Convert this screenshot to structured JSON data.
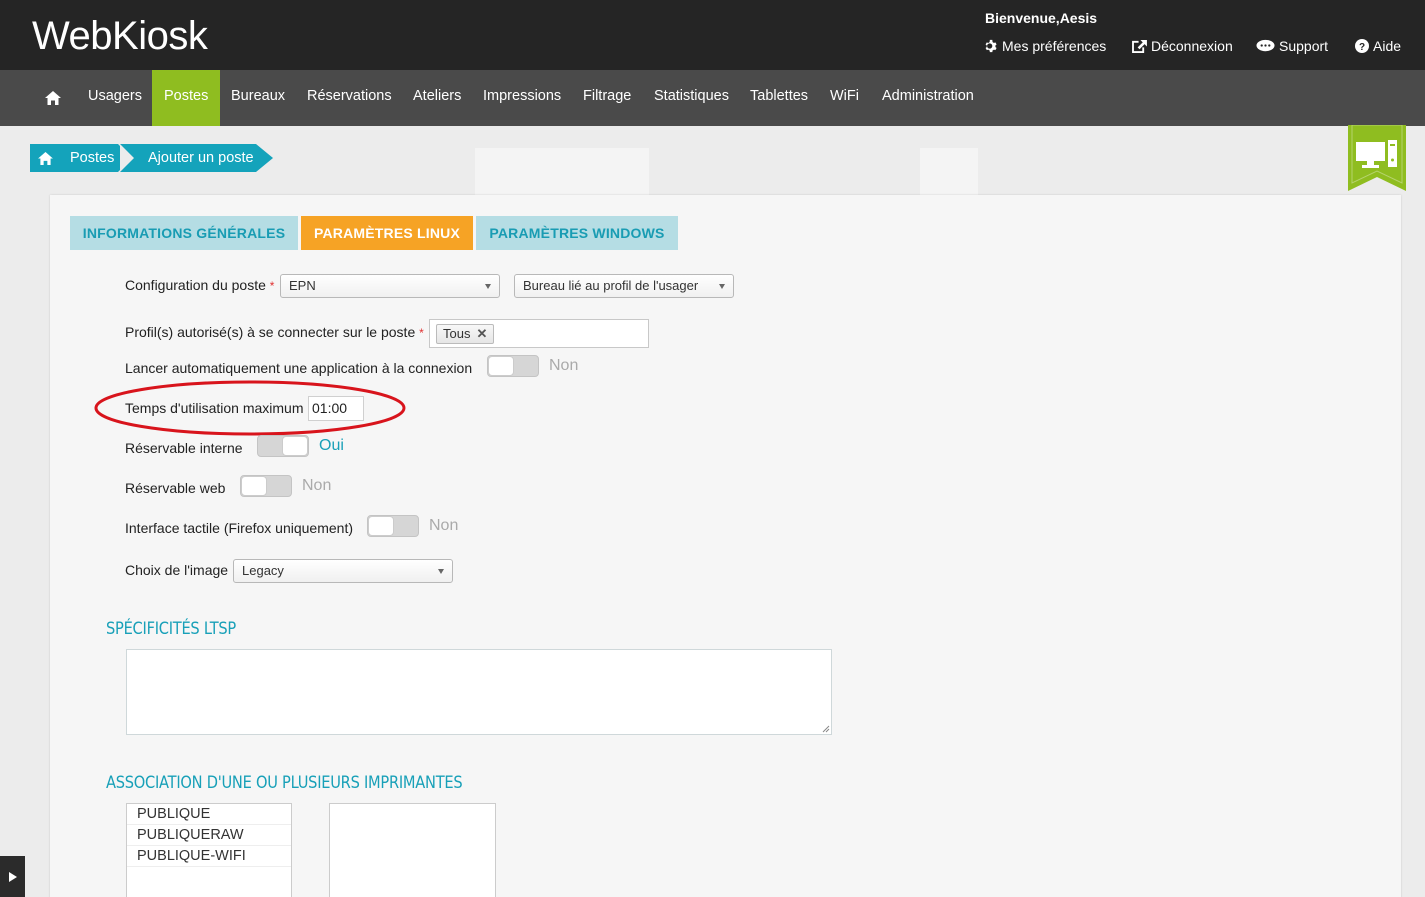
{
  "app": {
    "logo": "WebKiosk"
  },
  "header": {
    "welcome": "Bienvenue,Aesis",
    "links": [
      {
        "label": "Mes préférences",
        "icon": "gear-icon"
      },
      {
        "label": "Déconnexion",
        "icon": "external-link-icon"
      },
      {
        "label": "Support",
        "icon": "chat-bubble-icon"
      },
      {
        "label": "Aide",
        "icon": "help-icon"
      }
    ]
  },
  "nav": {
    "items": [
      "Usagers",
      "Postes",
      "Bureaux",
      "Réservations",
      "Ateliers",
      "Impressions",
      "Filtrage",
      "Statistiques",
      "Tablettes",
      "WiFi",
      "Administration"
    ],
    "active": "Postes"
  },
  "breadcrumb": {
    "items": [
      "Postes",
      "Ajouter un poste"
    ]
  },
  "tabs": [
    "INFORMATIONS GÉNÉRALES",
    "PARAMÈTRES LINUX",
    "PARAMÈTRES WINDOWS"
  ],
  "active_tab": "PARAMÈTRES LINUX",
  "form": {
    "config_label": "Configuration du poste",
    "config_value": "EPN",
    "bureau_value": "Bureau lié au profil de l'usager",
    "profils_label": "Profil(s) autorisé(s) à se connecter sur le poste",
    "profils_tag": "Tous",
    "required_mark": "*",
    "autolaunch_label": "Lancer automatiquement une application à la connexion",
    "autolaunch_value": "Non",
    "max_time_label": "Temps d'utilisation maximum",
    "max_time_value": "01:00",
    "reservable_interne_label": "Réservable interne",
    "reservable_interne_value": "Oui",
    "reservable_web_label": "Réservable web",
    "reservable_web_value": "Non",
    "tactile_label": "Interface tactile (Firefox uniquement)",
    "tactile_value": "Non",
    "image_label": "Choix de l'image",
    "image_value": "Legacy"
  },
  "sections": {
    "ltsp_title": "SPÉCIFICITÉS LTSP",
    "printers_title": "ASSOCIATION D'UNE OU PLUSIEURS IMPRIMANTES"
  },
  "printers": {
    "available": [
      "PUBLIQUE",
      "PUBLIQUERAW",
      "PUBLIQUE-WIFI"
    ],
    "selected": []
  },
  "colors": {
    "accent_teal": "#14a3bb",
    "active_nav": "#8fbd20",
    "active_tab": "#f6a325",
    "highlight_ring": "#d8141c"
  }
}
